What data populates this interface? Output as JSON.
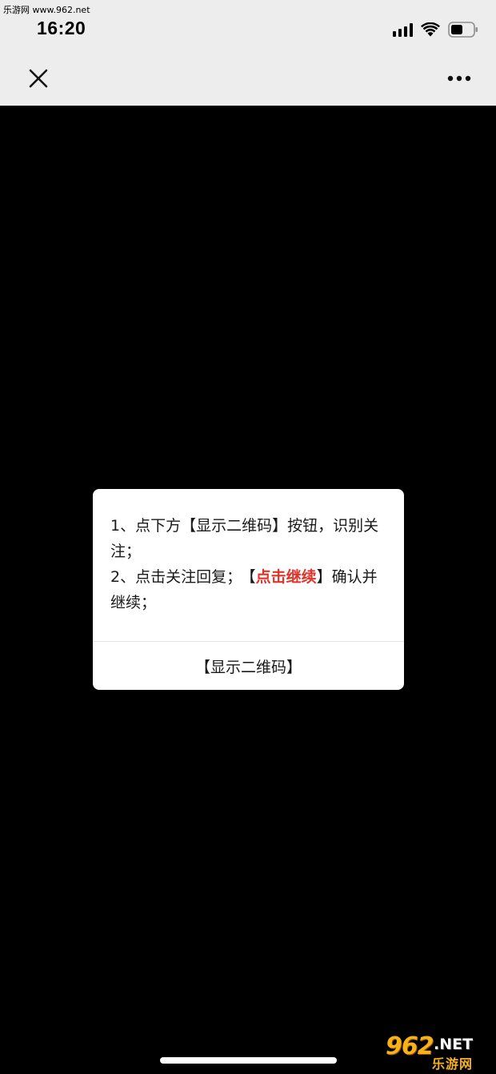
{
  "status_bar": {
    "watermark_text": "乐游网 www.962.net",
    "time": "16:20"
  },
  "nav": {
    "close_icon": "close-icon",
    "more_icon": "more-dots-icon"
  },
  "dialog": {
    "line1": "1、点下方【显示二维码】按钮，识别关注；",
    "line2_prefix": "2、点击关注回复；",
    "line2_bracket_open": "【",
    "line2_highlight": "点击继续",
    "line2_bracket_close": "】",
    "line2_suffix": "确认并继续；",
    "action_label": "【显示二维码】"
  },
  "watermark": {
    "number": "962",
    "domain": ".NET",
    "name": "乐游网"
  },
  "colors": {
    "header_bg": "#ededed",
    "page_bg": "#000000",
    "dialog_bg": "#ffffff",
    "highlight_red": "#e0342b",
    "watermark_orange": "#f7b21a"
  }
}
